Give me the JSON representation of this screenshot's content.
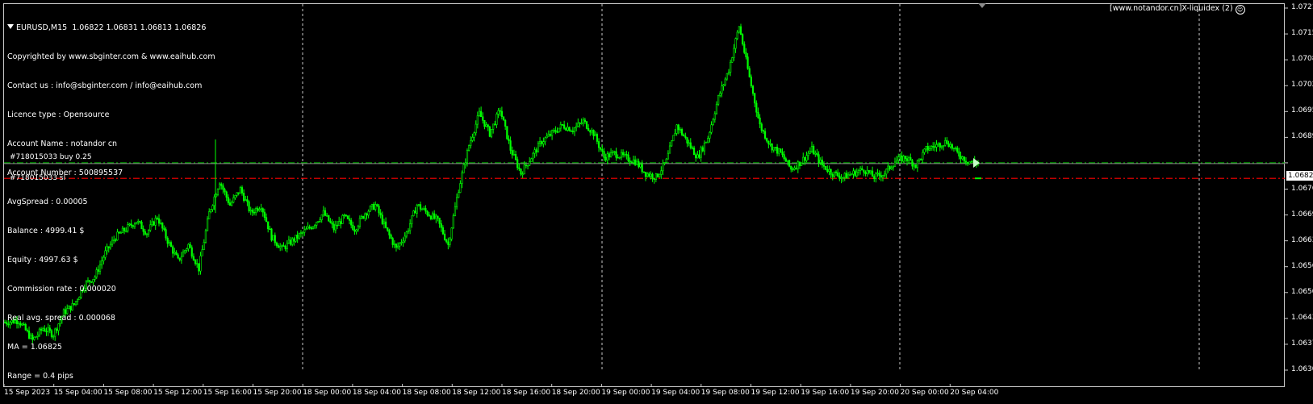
{
  "header": {
    "symbol_line": "EURUSD,M15  1.06822 1.06831 1.06813 1.06826"
  },
  "info_lines": [
    "Copyrighted by www.sbginter.com & www.eaihub.com",
    "Contact us : info@sbginter.com / info@eaihub.com",
    "Licence type : Opensource",
    "Account Name : notandor cn",
    "Account Number : 500895537",
    "AvgSpread : 0.00005",
    "Balance : 4999.41 $",
    "Equity : 4997.63 $",
    "Commission rate : 0.000020",
    "Real avg. spread : 0.000068",
    "MA = 1.06825",
    "Range = 0.4 pips"
  ],
  "ea_label": "[www.notandor.cn]X-liquidex (2)",
  "ea_icon": "smiley-icon",
  "orders": {
    "buy_label": "#718015033 buy 0.25",
    "buy_price": 1.06826,
    "sl_label": "#718015033 sl",
    "sl_price": 1.06787
  },
  "current_price": "1.06826",
  "colors": {
    "background": "#000000",
    "candles": "#00ff00",
    "buy_line": "#00c000",
    "sl_line": "#ff0000",
    "grid": "#c8c8c8"
  },
  "price_axis": [
    "1.07215",
    "1.07150",
    "1.07085",
    "1.07020",
    "1.06955",
    "1.06890",
    "1.06826",
    "1.06760",
    "1.06695",
    "1.06630",
    "1.06565",
    "1.06500",
    "1.06435",
    "1.06370",
    "1.06305"
  ],
  "time_axis": [
    "15 Sep 2023",
    "15 Sep 04:00",
    "15 Sep 08:00",
    "15 Sep 12:00",
    "15 Sep 16:00",
    "15 Sep 20:00",
    "18 Sep 00:00",
    "18 Sep 04:00",
    "18 Sep 08:00",
    "18 Sep 12:00",
    "18 Sep 16:00",
    "18 Sep 20:00",
    "19 Sep 00:00",
    "19 Sep 04:00",
    "19 Sep 08:00",
    "19 Sep 12:00",
    "19 Sep 16:00",
    "19 Sep 20:00",
    "20 Sep 00:00",
    "20 Sep 04:00"
  ],
  "chart_data": {
    "type": "candlestick",
    "symbol": "EURUSD",
    "timeframe": "M15",
    "ylim": [
      1.0627,
      1.0725
    ],
    "period_separators": [
      "18 Sep 00:00",
      "19 Sep 00:00",
      "20 Sep 00:00"
    ],
    "series_close_path": [
      [
        0,
        1.06425
      ],
      [
        8,
        1.0643
      ],
      [
        16,
        1.0638
      ],
      [
        22,
        1.0641
      ],
      [
        28,
        1.06395
      ],
      [
        34,
        1.0645
      ],
      [
        40,
        1.0647
      ],
      [
        46,
        1.0652
      ],
      [
        52,
        1.0654
      ],
      [
        58,
        1.066
      ],
      [
        64,
        1.0664
      ],
      [
        70,
        1.0666
      ],
      [
        76,
        1.0668
      ],
      [
        82,
        1.0665
      ],
      [
        88,
        1.0669
      ],
      [
        94,
        1.0663
      ],
      [
        100,
        1.0658
      ],
      [
        106,
        1.0662
      ],
      [
        112,
        1.0656
      ],
      [
        118,
        1.067
      ],
      [
        124,
        1.0678
      ],
      [
        130,
        1.0672
      ],
      [
        136,
        1.0676
      ],
      [
        142,
        1.067
      ],
      [
        148,
        1.0672
      ],
      [
        154,
        1.0664
      ],
      [
        160,
        1.0661
      ],
      [
        166,
        1.0663
      ],
      [
        172,
        1.0665
      ],
      [
        178,
        1.0667
      ],
      [
        184,
        1.067
      ],
      [
        190,
        1.0666
      ],
      [
        196,
        1.0669
      ],
      [
        202,
        1.0666
      ],
      [
        208,
        1.067
      ],
      [
        214,
        1.0672
      ],
      [
        220,
        1.0666
      ],
      [
        226,
        1.0661
      ],
      [
        232,
        1.0665
      ],
      [
        238,
        1.0672
      ],
      [
        244,
        1.067
      ],
      [
        250,
        1.0668
      ],
      [
        256,
        1.0662
      ],
      [
        262,
        1.0676
      ],
      [
        268,
        1.0687
      ],
      [
        274,
        1.0695
      ],
      [
        280,
        1.069
      ],
      [
        286,
        1.0696
      ],
      [
        292,
        1.0686
      ],
      [
        298,
        1.068
      ],
      [
        304,
        1.0684
      ],
      [
        310,
        1.0688
      ],
      [
        316,
        1.069
      ],
      [
        322,
        1.0692
      ],
      [
        328,
        1.0691
      ],
      [
        334,
        1.0693
      ],
      [
        340,
        1.069
      ],
      [
        346,
        1.0684
      ],
      [
        352,
        1.0685
      ],
      [
        358,
        1.0684
      ],
      [
        364,
        1.0683
      ],
      [
        370,
        1.068
      ],
      [
        376,
        1.0679
      ],
      [
        382,
        1.0683
      ],
      [
        388,
        1.0692
      ],
      [
        394,
        1.0688
      ],
      [
        400,
        1.0684
      ],
      [
        406,
        1.0689
      ],
      [
        412,
        1.0699
      ],
      [
        418,
        1.0706
      ],
      [
        424,
        1.0717
      ],
      [
        430,
        1.0704
      ],
      [
        436,
        1.0692
      ],
      [
        442,
        1.0687
      ],
      [
        448,
        1.0685
      ],
      [
        454,
        1.0681
      ],
      [
        460,
        1.0683
      ],
      [
        466,
        1.0686
      ],
      [
        472,
        1.0682
      ],
      [
        478,
        1.068
      ],
      [
        484,
        1.0679
      ],
      [
        490,
        1.068
      ],
      [
        496,
        1.0681
      ],
      [
        502,
        1.0679
      ],
      [
        508,
        1.068
      ],
      [
        514,
        1.0683
      ],
      [
        520,
        1.0684
      ],
      [
        526,
        1.0682
      ],
      [
        532,
        1.0686
      ],
      [
        538,
        1.0687
      ],
      [
        544,
        1.0688
      ],
      [
        550,
        1.0685
      ],
      [
        556,
        1.0683
      ],
      [
        562,
        1.06826
      ]
    ]
  }
}
